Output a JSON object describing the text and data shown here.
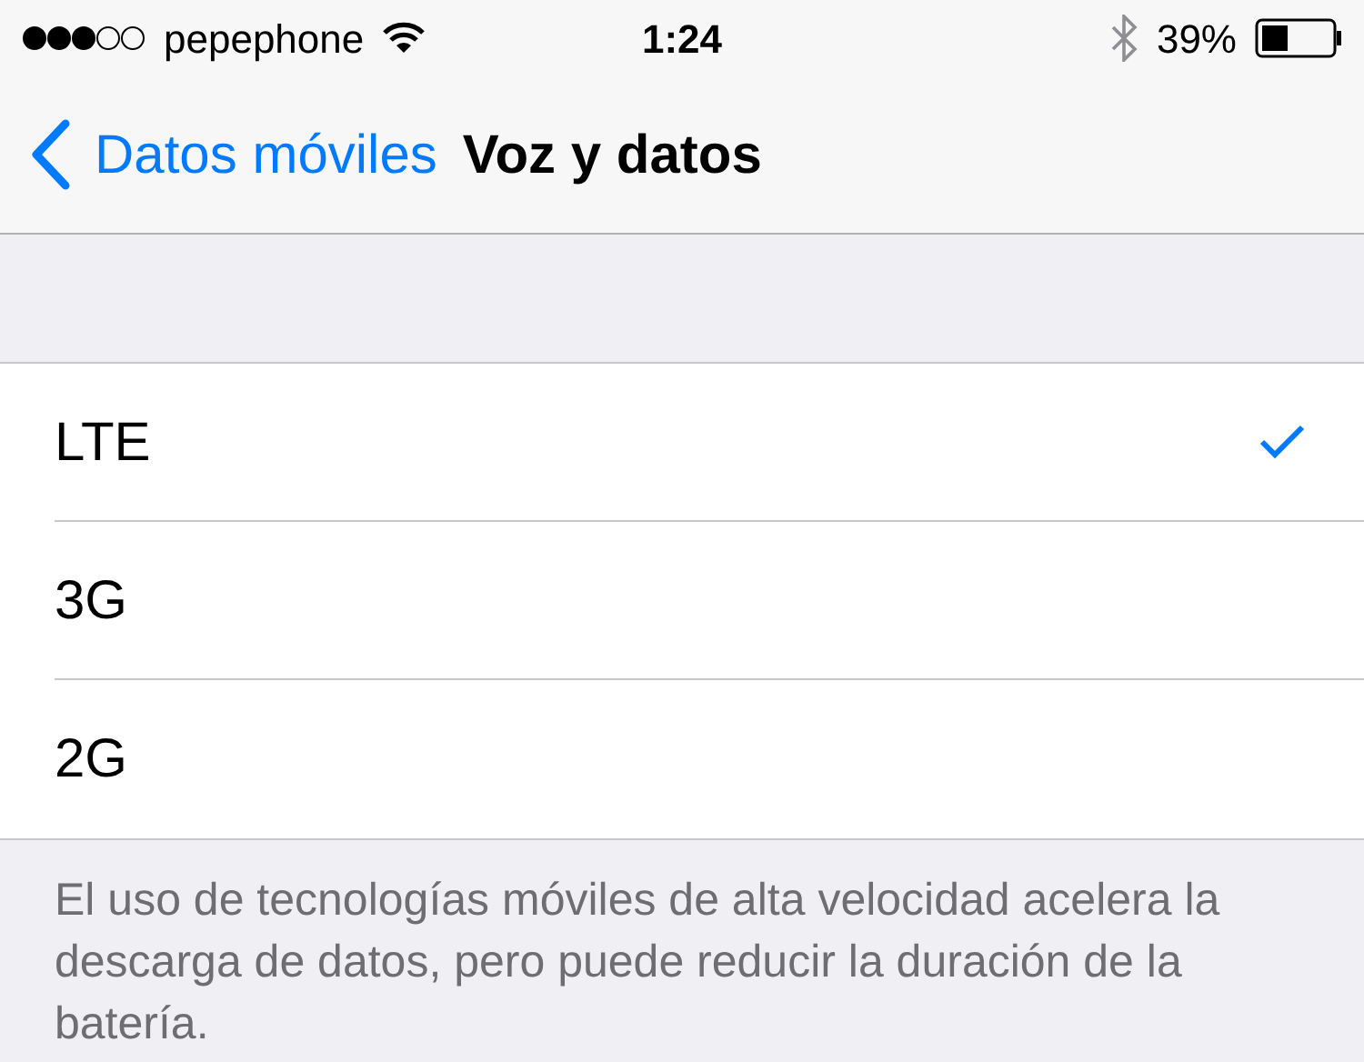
{
  "status_bar": {
    "carrier": "pepephone",
    "time": "1:24",
    "battery": "39%"
  },
  "nav_bar": {
    "back": "Datos móviles",
    "title": "Voz y datos"
  },
  "options": [
    {
      "label": "LTE",
      "selected": true
    },
    {
      "label": "3G",
      "selected": false
    },
    {
      "label": "2G",
      "selected": false
    }
  ],
  "footer": "El uso de tecnologías móviles de alta velocidad acelera la descarga de datos, pero puede reducir la duración de la batería."
}
